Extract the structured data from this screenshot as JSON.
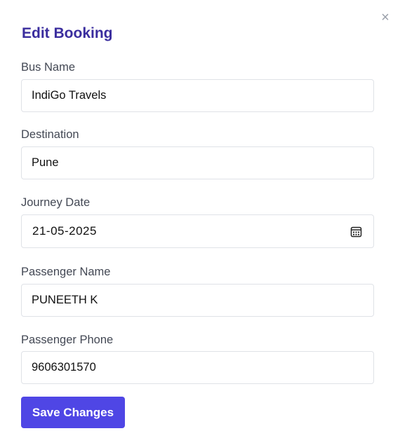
{
  "dialog": {
    "title": "Edit Booking",
    "close_icon": "close-icon",
    "close_glyph": "×"
  },
  "fields": {
    "bus_name": {
      "label": "Bus Name",
      "value": "IndiGo Travels"
    },
    "destination": {
      "label": "Destination",
      "value": "Pune"
    },
    "journey_date": {
      "label": "Journey Date",
      "value": "21-05-2025",
      "icon": "calendar-icon"
    },
    "passenger_name": {
      "label": "Passenger Name",
      "value": "PUNEETH K"
    },
    "passenger_phone": {
      "label": "Passenger Phone",
      "value": "9606301570"
    }
  },
  "actions": {
    "save_label": "Save Changes"
  },
  "colors": {
    "title": "#3a2d9e",
    "primary_button": "#4f46e5",
    "label": "#434854",
    "border": "#dfe2e7"
  }
}
